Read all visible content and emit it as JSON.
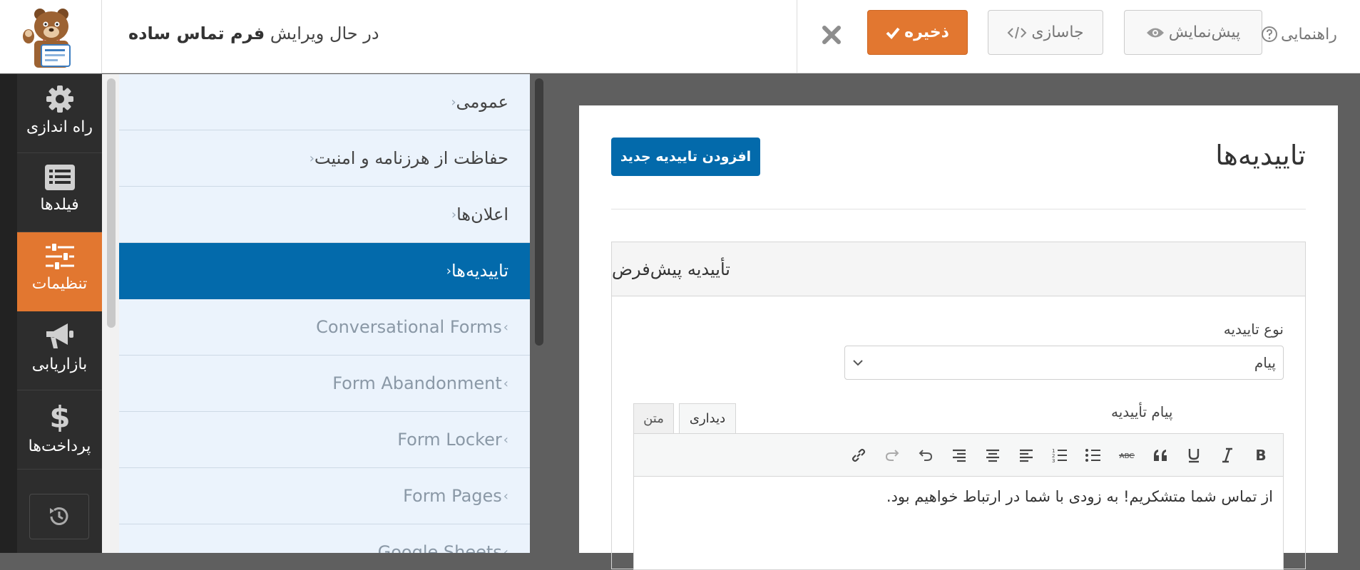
{
  "header": {
    "editing_prefix": "در حال ویرایش",
    "form_name": "فرم تماس ساده",
    "save_label": "ذخیره",
    "embed_label": "جاسازی",
    "preview_label": "پیش‌نمایش",
    "help_label": "راهنمایی"
  },
  "sidebar": {
    "items": [
      {
        "label": "راه اندازی",
        "icon": "gear-icon"
      },
      {
        "label": "فیلدها",
        "icon": "fields-list-icon"
      },
      {
        "label": "تنظیمات",
        "icon": "sliders-icon"
      },
      {
        "label": "بازاریابی",
        "icon": "megaphone-icon"
      },
      {
        "label": "پرداخت‌ها",
        "icon": "dollar-icon"
      }
    ],
    "active_index": 2
  },
  "settings_nav": {
    "items": [
      {
        "label": "عمومی"
      },
      {
        "label": "حفاظت از هرزنامه و امنیت"
      },
      {
        "label": "اعلان‌ها"
      },
      {
        "label": "تاییدیه‌ها"
      },
      {
        "label": "Conversational Forms"
      },
      {
        "label": "Form Abandonment"
      },
      {
        "label": "Form Locker"
      },
      {
        "label": "Form Pages"
      },
      {
        "label": "Google Sheets"
      }
    ],
    "active_index": 3
  },
  "content": {
    "section_title": "تاییدیه‌ها",
    "add_button": "افزودن تاییدیه جدید",
    "confirmation_title": "تأییدیه پیش‌فرض",
    "type_label": "نوع تاییدیه",
    "type_value": "پیام",
    "message_label": "پیام تأییدیه",
    "tab_visual": "دیداری",
    "tab_text": "متن",
    "message_text": "از تماس شما متشکریم! به زودی با شما در ارتباط خواهیم بود."
  },
  "colors": {
    "accent_orange": "#e27730",
    "primary_blue": "#036aab",
    "sidebar_dark": "#2d2d2d",
    "nav_bg": "#ebf3fc"
  }
}
